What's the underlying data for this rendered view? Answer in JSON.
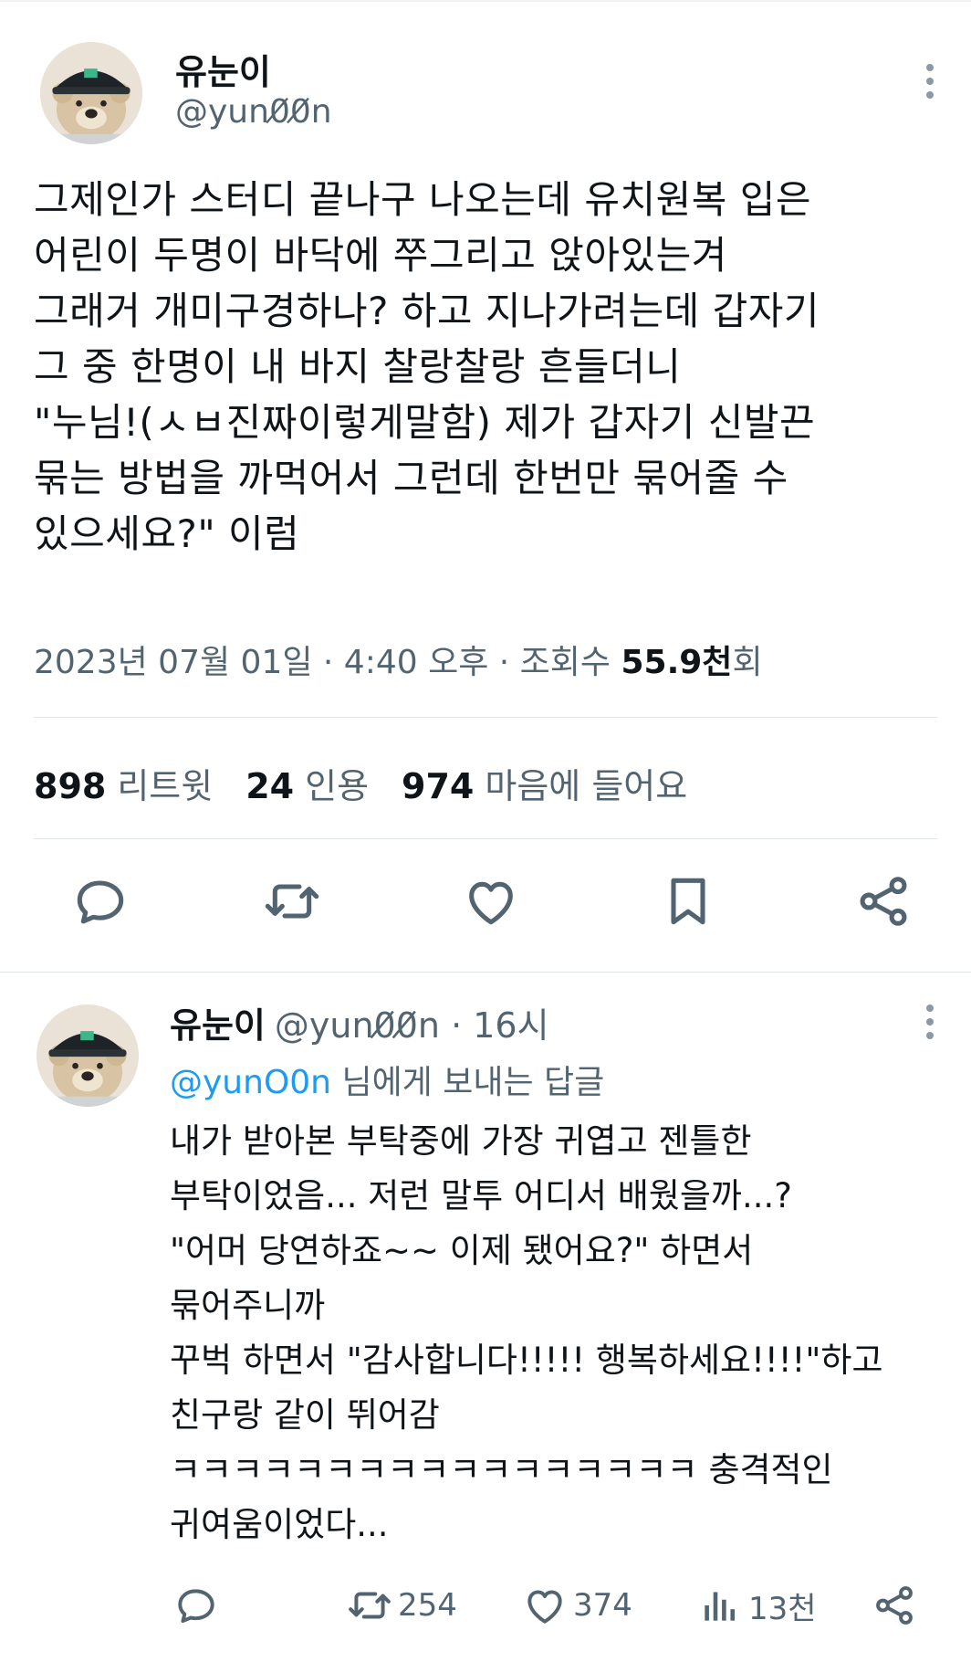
{
  "main_tweet": {
    "display_name": "유눈이",
    "handle": "@yun0̸0̸n",
    "text": "그제인가 스터디 끝나구 나오는데 유치원복 입은\n어린이 두명이 바닥에 쭈그리고 앉아있는겨\n그래거 개미구경하나? 하고 지나가려는데 갑자기\n그 중 한명이 내 바지 찰랑찰랑 흔들더니\n\"누님!(ㅅㅂ진짜이렇게말함) 제가 갑자기 신발끈\n묶는 방법을 까먹어서 그런데 한번만 묶어줄 수\n있으세요?\" 이럼",
    "meta": {
      "datetime": "2023년 07월 01일 · 4:40 오후 · 조회수 ",
      "views_value": "55.9천",
      "views_suffix": "회"
    },
    "stats": {
      "retweets_num": "898",
      "retweets_label": "리트윗",
      "quotes_num": "24",
      "quotes_label": "인용",
      "likes_num": "974",
      "likes_label": "마음에 들어요"
    },
    "icons": [
      "reply-icon",
      "retweet-icon",
      "like-icon",
      "bookmark-icon",
      "share-icon"
    ]
  },
  "reply": {
    "display_name": "유눈이",
    "handle_time": "@yun0̸0̸n · 16시",
    "replying_mention": "@yunO0n",
    "replying_suffix": " 님에게 보내는 답글",
    "text": "내가 받아본 부탁중에 가장 귀엽고 젠틀한\n부탁이었음... 저런 말투 어디서 배웠을까...?\n\"어머 당연하죠~~ 이제 됐어요?\" 하면서\n묶어주니까\n꾸벅 하면서 \"감사합니다!!!!! 행복하세요!!!!\"하고\n친구랑 같이 뛰어감\nㅋㅋㅋㅋㅋㅋㅋㅋㅋㅋㅋㅋㅋㅋㅋㅋㅋ 충격적인\n귀여움이었다...",
    "retweets": "254",
    "likes": "374",
    "views": "13천"
  },
  "colors": {
    "text_primary": "#0f1419",
    "text_secondary": "#536471",
    "link": "#1d9bf0",
    "divider": "#dfe4e7"
  }
}
